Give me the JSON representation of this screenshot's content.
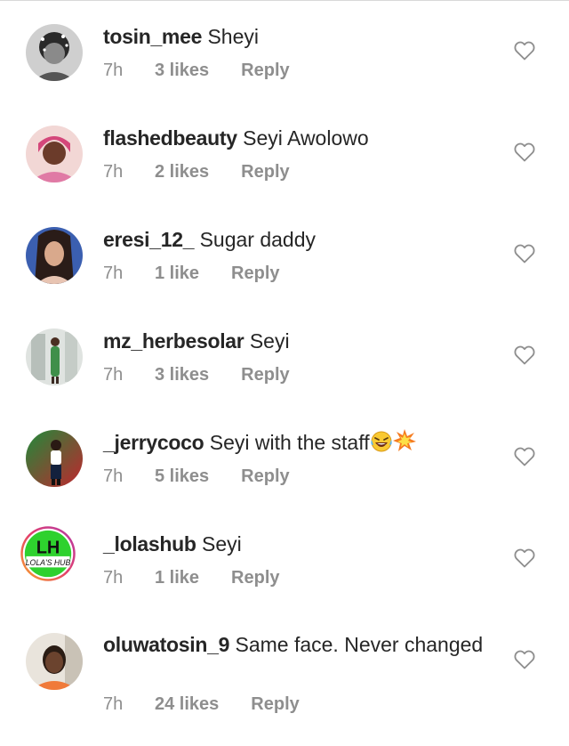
{
  "comments": [
    {
      "username": "tosin_mee",
      "text": "Sheyi",
      "time": "7h",
      "likes": "3 likes",
      "reply": "Reply"
    },
    {
      "username": "flashedbeauty",
      "text": "Seyi Awolowo",
      "time": "7h",
      "likes": "2 likes",
      "reply": "Reply"
    },
    {
      "username": "eresi_12_",
      "text": "Sugar daddy",
      "time": "7h",
      "likes": "1 like",
      "reply": "Reply"
    },
    {
      "username": "mz_herbesolar",
      "text": "Seyi",
      "time": "7h",
      "likes": "3 likes",
      "reply": "Reply"
    },
    {
      "username": "_jerrycoco",
      "text": "Seyi with the staff",
      "time": "7h",
      "likes": "5 likes",
      "reply": "Reply",
      "emoji": [
        "laughing-crying-emoji",
        "collision-emoji"
      ]
    },
    {
      "username": "_lolashub",
      "text": "Seyi",
      "time": "7h",
      "likes": "1 like",
      "reply": "Reply",
      "avatar_logo": {
        "big": "LH",
        "small": "LOLA'S HUB"
      }
    },
    {
      "username": "oluwatosin_9",
      "text": "Same face. Never changed",
      "time": "7h",
      "likes": "24 likes",
      "reply": "Reply"
    }
  ],
  "icons": {
    "like": "heart-outline-icon"
  },
  "colors": {
    "username_text": "#262626",
    "meta_text": "#8e8e8e",
    "heart_stroke": "#8e8e8e"
  }
}
